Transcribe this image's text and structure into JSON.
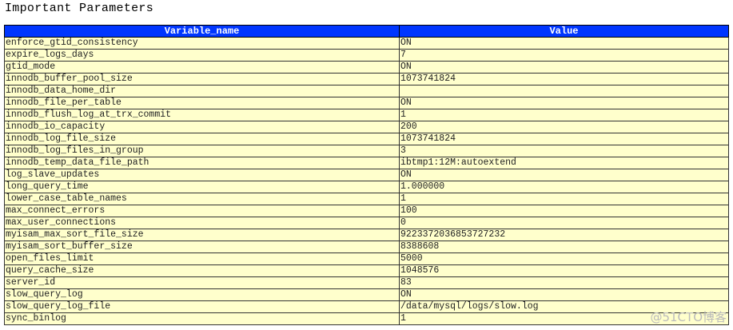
{
  "title": "Important Parameters",
  "columns": [
    "Variable_name",
    "Value"
  ],
  "rows": [
    [
      "enforce_gtid_consistency",
      "ON"
    ],
    [
      "expire_logs_days",
      "7"
    ],
    [
      "gtid_mode",
      "ON"
    ],
    [
      "innodb_buffer_pool_size",
      "1073741824"
    ],
    [
      "innodb_data_home_dir",
      ""
    ],
    [
      "innodb_file_per_table",
      "ON"
    ],
    [
      "innodb_flush_log_at_trx_commit",
      "1"
    ],
    [
      "innodb_io_capacity",
      "200"
    ],
    [
      "innodb_log_file_size",
      "1073741824"
    ],
    [
      "innodb_log_files_in_group",
      "3"
    ],
    [
      "innodb_temp_data_file_path",
      "ibtmp1:12M:autoextend"
    ],
    [
      "log_slave_updates",
      "ON"
    ],
    [
      "long_query_time",
      "1.000000"
    ],
    [
      "lower_case_table_names",
      "1"
    ],
    [
      "max_connect_errors",
      "100"
    ],
    [
      "max_user_connections",
      "0"
    ],
    [
      "myisam_max_sort_file_size",
      "9223372036853727232"
    ],
    [
      "myisam_sort_buffer_size",
      "8388608"
    ],
    [
      "open_files_limit",
      "5000"
    ],
    [
      "query_cache_size",
      "1048576"
    ],
    [
      "server_id",
      "83"
    ],
    [
      "slow_query_log",
      "ON"
    ],
    [
      "slow_query_log_file",
      "/data/mysql/logs/slow.log"
    ],
    [
      "sync_binlog",
      "1"
    ]
  ],
  "watermark": "@51CTO博客"
}
